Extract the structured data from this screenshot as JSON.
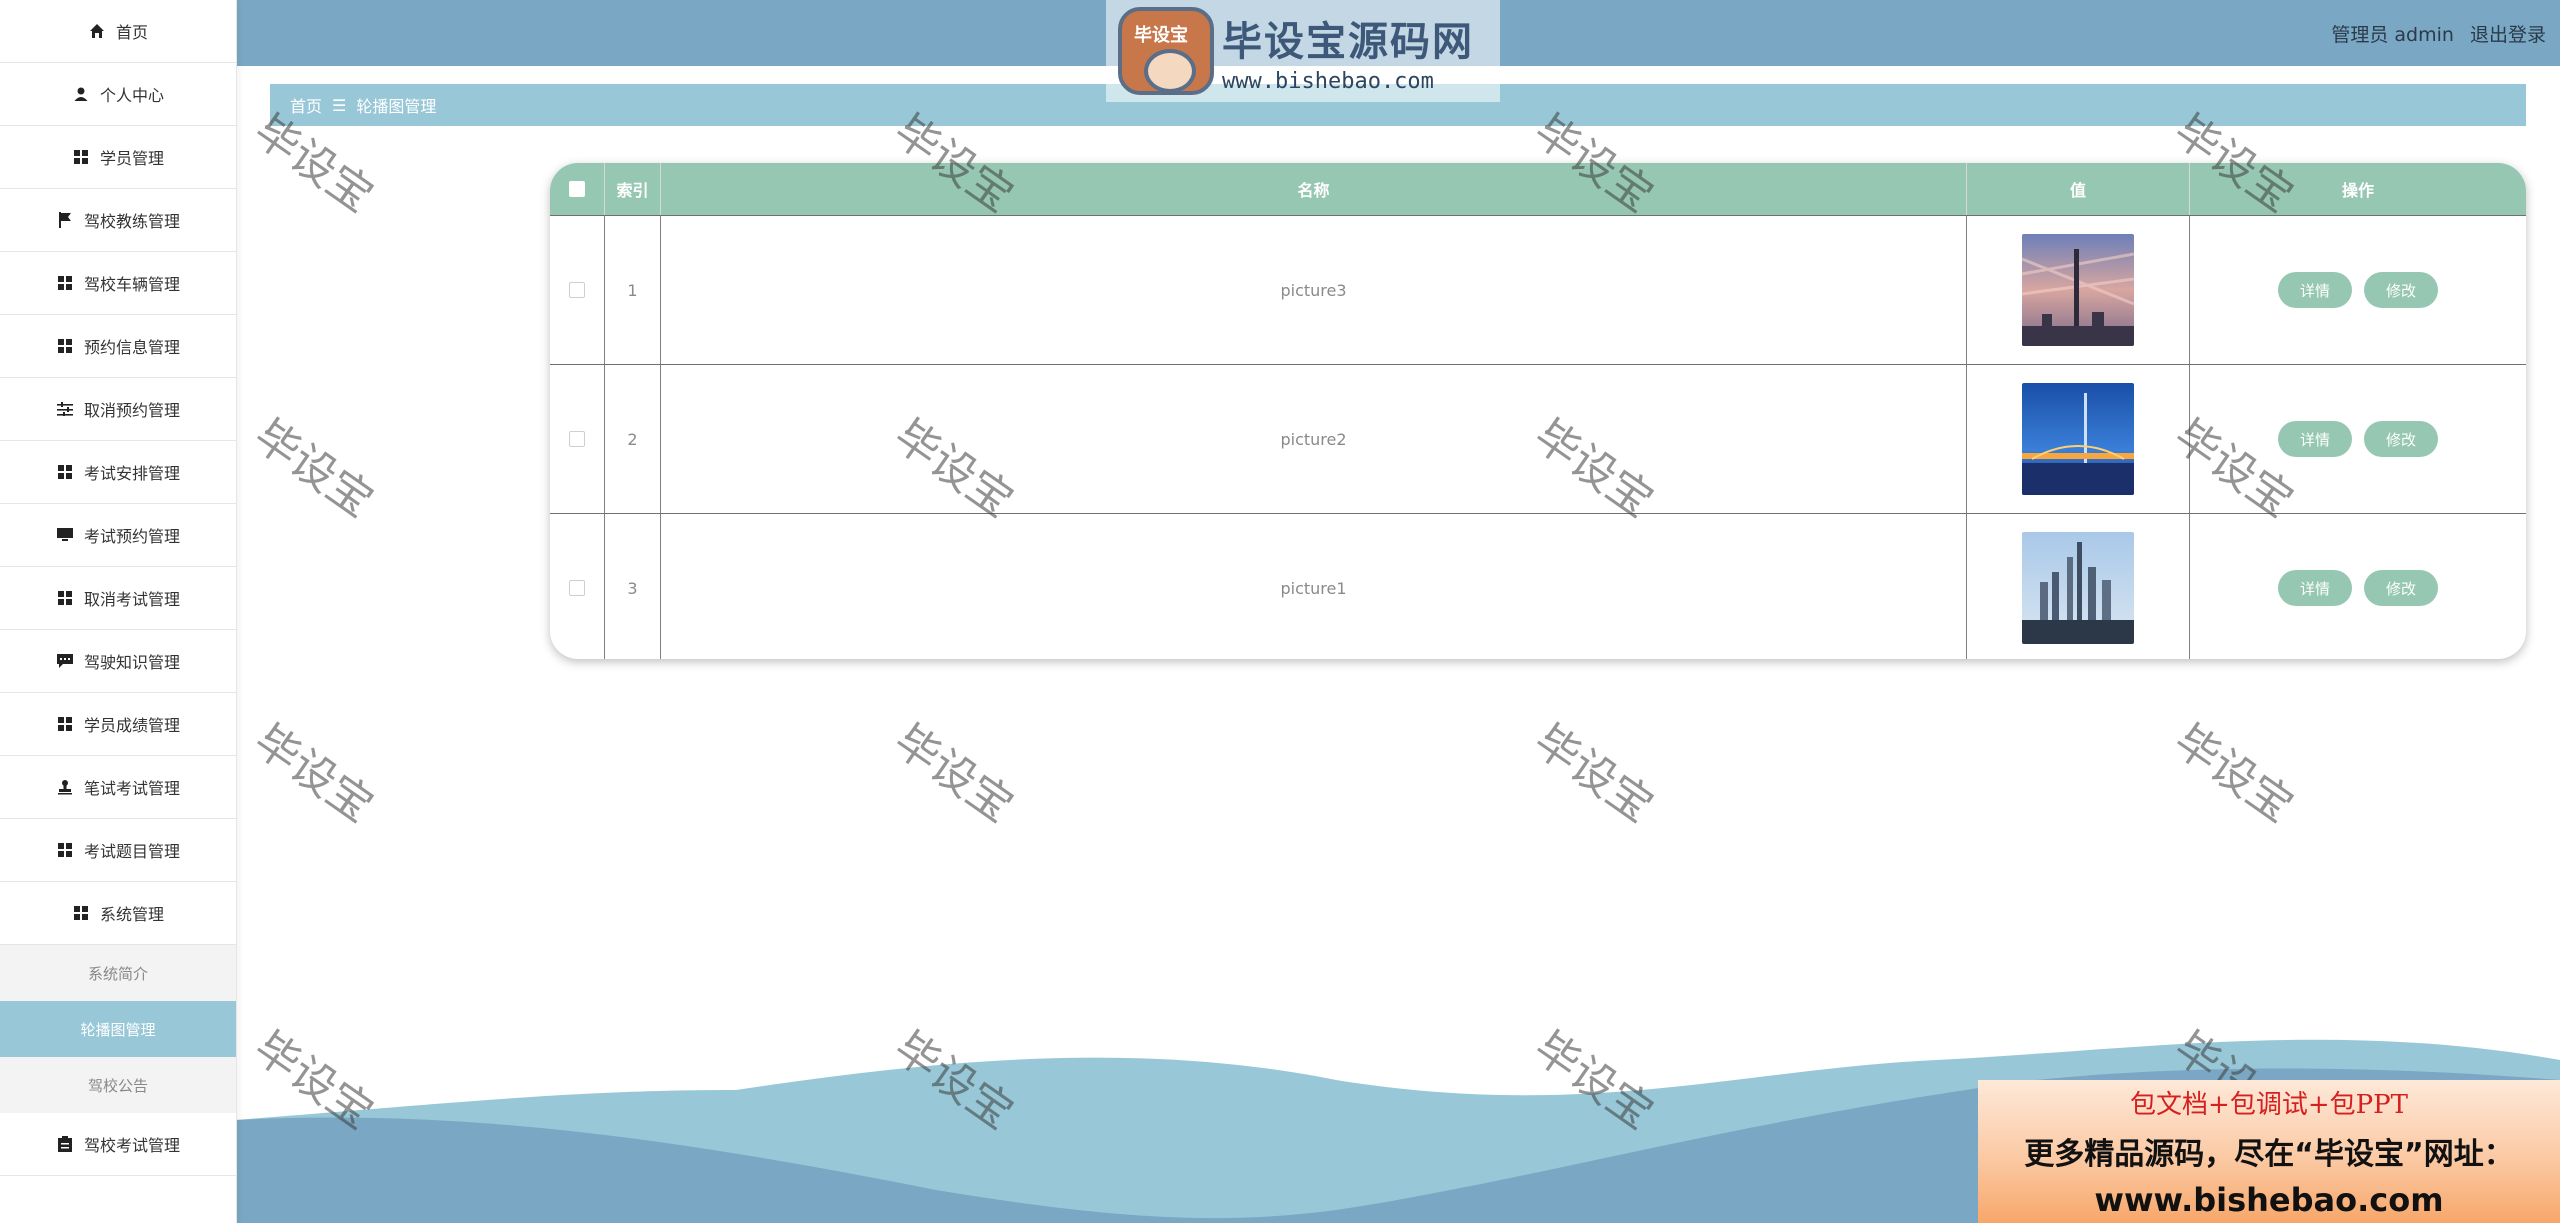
{
  "sidebar": {
    "items": [
      {
        "label": "首页",
        "icon": "home-icon"
      },
      {
        "label": "个人中心",
        "icon": "user-icon"
      },
      {
        "label": "学员管理",
        "icon": "grid-icon"
      },
      {
        "label": "驾校教练管理",
        "icon": "flag-icon"
      },
      {
        "label": "驾校车辆管理",
        "icon": "grid-icon"
      },
      {
        "label": "预约信息管理",
        "icon": "grid-icon"
      },
      {
        "label": "取消预约管理",
        "icon": "sliders-icon"
      },
      {
        "label": "考试安排管理",
        "icon": "grid-icon"
      },
      {
        "label": "考试预约管理",
        "icon": "monitor-icon"
      },
      {
        "label": "取消考试管理",
        "icon": "grid-icon"
      },
      {
        "label": "驾驶知识管理",
        "icon": "chat-icon"
      },
      {
        "label": "学员成绩管理",
        "icon": "grid-icon"
      },
      {
        "label": "笔试考试管理",
        "icon": "stamp-icon"
      },
      {
        "label": "考试题目管理",
        "icon": "grid-icon"
      },
      {
        "label": "系统管理",
        "icon": "grid-icon"
      }
    ],
    "submenu": [
      "系统简介",
      "轮播图管理",
      "驾校公告"
    ],
    "last_item": {
      "label": "驾校考试管理",
      "icon": "clipboard-icon"
    }
  },
  "header": {
    "user_label": "管理员 admin",
    "logout_label": "退出登录"
  },
  "logo": {
    "badge_text": "毕设宝",
    "title": "毕设宝源码网",
    "url": "www.bishebao.com"
  },
  "breadcrumb": {
    "home": "首页",
    "separator": "☰",
    "current": "轮播图管理"
  },
  "table": {
    "headers": {
      "index": "索引",
      "name": "名称",
      "value": "值",
      "actions": "操作"
    },
    "rows": [
      {
        "index": "1",
        "name": "picture3",
        "detail": "详情",
        "edit": "修改"
      },
      {
        "index": "2",
        "name": "picture2",
        "detail": "详情",
        "edit": "修改"
      },
      {
        "index": "3",
        "name": "picture1",
        "detail": "详情",
        "edit": "修改"
      }
    ]
  },
  "watermark_text": "毕设宝",
  "ad": {
    "line1": "包文档+包调试+包PPT",
    "line2": "更多精品源码，尽在“毕设宝”网址：",
    "line3": "www.bishebao.com"
  },
  "colors": {
    "header_bg": "#7aa8c4",
    "accent": "#98c8d8",
    "table_header": "#95c7b3",
    "button": "#95c7b3"
  }
}
